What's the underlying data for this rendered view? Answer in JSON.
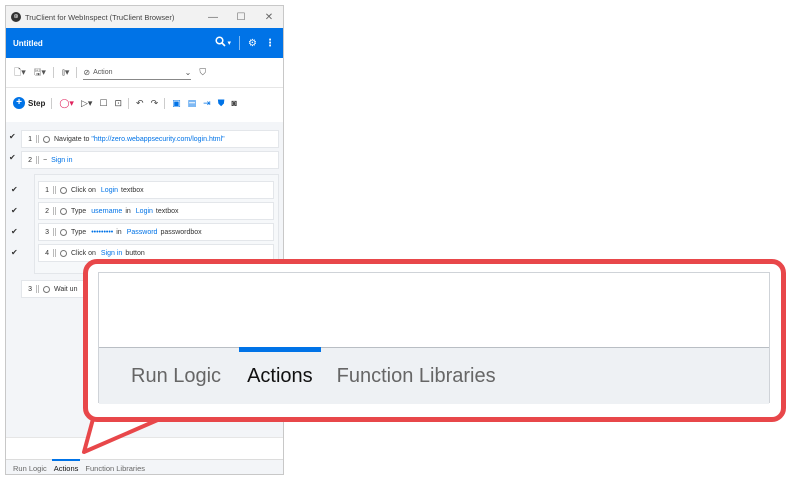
{
  "window": {
    "title": "TruClient for WebInspect (TruClient Browser)",
    "controls": [
      "—",
      "☐",
      "✕"
    ]
  },
  "header": {
    "doc_title": "Untitled"
  },
  "toolbar": {
    "action_select": "Action"
  },
  "toolbar2": {
    "step_label": "Step"
  },
  "steps": [
    {
      "num": "1",
      "parts": [
        {
          "t": "Navigate to ",
          "k": "plain"
        },
        {
          "t": "\"http://zero.webappsecurity.com/login.html\"",
          "k": "link"
        }
      ]
    },
    {
      "num": "2",
      "parts": [
        {
          "t": "Sign in",
          "k": "link"
        }
      ]
    },
    {
      "num": "3",
      "parts": [
        {
          "t": "Wait un",
          "k": "plain"
        }
      ]
    }
  ],
  "substeps": [
    {
      "num": "1",
      "parts": [
        {
          "t": "Click on",
          "k": "plain"
        },
        {
          "t": "Login",
          "k": "link"
        },
        {
          "t": "textbox",
          "k": "plain"
        }
      ]
    },
    {
      "num": "2",
      "parts": [
        {
          "t": "Type",
          "k": "plain"
        },
        {
          "t": "username",
          "k": "link"
        },
        {
          "t": "in",
          "k": "plain"
        },
        {
          "t": "Login",
          "k": "link"
        },
        {
          "t": "textbox",
          "k": "plain"
        }
      ]
    },
    {
      "num": "3",
      "parts": [
        {
          "t": "Type",
          "k": "plain"
        },
        {
          "t": "•••••••••",
          "k": "link"
        },
        {
          "t": "in",
          "k": "plain"
        },
        {
          "t": "Password",
          "k": "link"
        },
        {
          "t": "passwordbox",
          "k": "plain"
        }
      ]
    },
    {
      "num": "4",
      "parts": [
        {
          "t": "Click on",
          "k": "plain"
        },
        {
          "t": "Sign in",
          "k": "link"
        },
        {
          "t": "button",
          "k": "plain"
        }
      ]
    }
  ],
  "tabs": {
    "run_logic": "Run Logic",
    "actions": "Actions",
    "function_libraries": "Function Libraries",
    "active": "Actions"
  },
  "colors": {
    "accent": "#0073e7",
    "callout": "#e8474a"
  }
}
